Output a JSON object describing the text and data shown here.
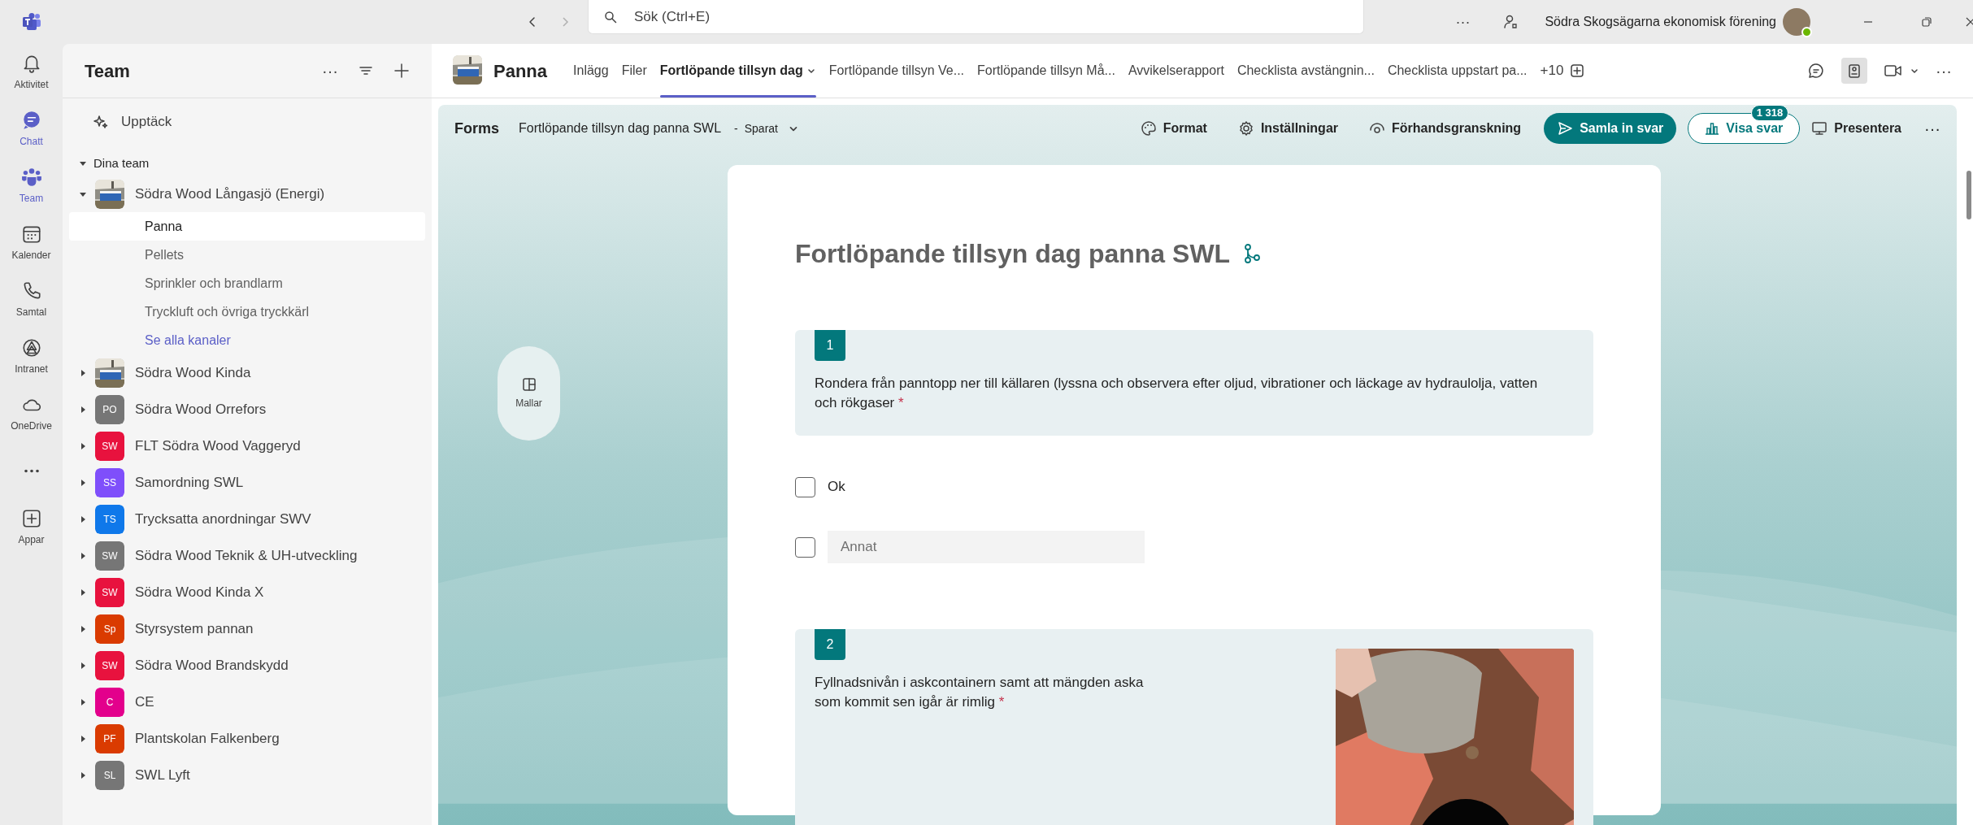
{
  "titlebar": {
    "search": {
      "placeholder": "Sök (Ctrl+E)"
    },
    "more": "···",
    "organization": "Södra Skogsägarna ekonomisk förening"
  },
  "rail": [
    {
      "kind": "app",
      "label": "Aktivitet",
      "selected": false
    },
    {
      "kind": "app",
      "label": "Chatt",
      "selected": true
    },
    {
      "kind": "app",
      "label": "Team",
      "selected": true
    },
    {
      "kind": "app",
      "label": "Kalender",
      "selected": false
    },
    {
      "kind": "app",
      "label": "Samtal",
      "selected": false
    },
    {
      "kind": "app",
      "label": "Intranet",
      "selected": false
    },
    {
      "kind": "app",
      "label": "OneDrive",
      "selected": false
    },
    {
      "kind": "more",
      "selected": false
    },
    {
      "kind": "app",
      "label": "Appar",
      "selected": false
    }
  ],
  "sidebar": {
    "title": "Team",
    "more": "···",
    "discover": "Upptäck",
    "section": {
      "label": "Dina team",
      "expanded": true
    },
    "teams": [
      {
        "name": "Södra Wood Långasjö (Energi)",
        "expanded": true,
        "channels": [
          {
            "name": "Panna",
            "selected": true
          },
          {
            "name": "Pellets",
            "selected": false
          },
          {
            "name": "Sprinkler och brandlarm",
            "selected": false
          },
          {
            "name": "Tryckluft och övriga tryckkärl",
            "selected": false
          }
        ],
        "link": "Se alla kanaler"
      },
      {
        "name": "Södra Wood Kinda",
        "expanded": false
      },
      {
        "name": "Södra Wood Orrefors",
        "kind": "initials",
        "initials": "PO",
        "color": "#767676",
        "expanded": false
      },
      {
        "name": "FLT Södra Wood Vaggeryd",
        "kind": "initials",
        "initials": "SW",
        "color": "#e8123e",
        "expanded": false
      },
      {
        "name": "Samordning SWL",
        "kind": "initials",
        "initials": "SS",
        "color": "#7f4ffb",
        "expanded": false
      },
      {
        "name": "Trycksatta anordningar SWV",
        "kind": "initials",
        "initials": "TS",
        "color": "#0f78ea",
        "expanded": false
      },
      {
        "name": "Södra Wood Teknik & UH-utveckling",
        "kind": "initials",
        "initials": "SW",
        "color": "#767676",
        "expanded": false
      },
      {
        "name": "Södra Wood Kinda X",
        "kind": "initials",
        "initials": "SW",
        "color": "#e8123e",
        "expanded": false
      },
      {
        "name": "Styrsystem pannan",
        "kind": "initials",
        "initials": "Sp",
        "color": "#da3b01",
        "expanded": false
      },
      {
        "name": "Södra Wood Brandskydd",
        "kind": "initials",
        "initials": "SW",
        "color": "#e8123e",
        "expanded": false
      },
      {
        "name": "CE",
        "kind": "initials",
        "initials": "C",
        "color": "#e3008c",
        "expanded": false
      },
      {
        "name": "Plantskolan Falkenberg",
        "kind": "initials",
        "initials": "PF",
        "color": "#da3b01",
        "expanded": false
      },
      {
        "name": "SWL Lyft",
        "kind": "initials",
        "initials": "SL",
        "color": "#767676",
        "expanded": false
      }
    ]
  },
  "channel": {
    "name": "Panna",
    "tabs": [
      {
        "label": "Inlägg",
        "selected": false
      },
      {
        "label": "Filer",
        "selected": false
      },
      {
        "label": "Fortlöpande tillsyn dag",
        "selected": true
      },
      {
        "label": "Fortlöpande tillsyn Ve...",
        "selected": false
      },
      {
        "label": "Fortlöpande tillsyn Må...",
        "selected": false
      },
      {
        "label": "Avvikelserapport",
        "selected": false
      },
      {
        "label": "Checklista avstängnin...",
        "selected": false
      },
      {
        "label": "Checklista uppstart pa...",
        "selected": false
      }
    ],
    "more_tabs": "+10",
    "more": "···"
  },
  "forms_toolbar": {
    "app": "Forms",
    "form_name": "Fortlöpande tillsyn dag panna SWL",
    "separator": "-",
    "status": "Sparat",
    "actions": [
      "Format",
      "Inställningar",
      "Förhandsgranskning"
    ],
    "collect": "Samla in svar",
    "responses": "Visa svar",
    "response_count": "1 318",
    "present": "Presentera",
    "more": "···"
  },
  "templates": {
    "label": "Mallar"
  },
  "form": {
    "title": "Fortlöpande tillsyn dag panna SWL",
    "questions": [
      {
        "number": "1",
        "text": "Rondera från panntopp ner till källaren (lyssna och observera efter oljud, vibrationer och läckage av hydraulolja, vatten och rökgaser",
        "required_mark": "*",
        "options": [
          {
            "kind": "choice",
            "label": "Ok",
            "checked": false
          },
          {
            "kind": "other",
            "placeholder": "Annat",
            "checked": false
          }
        ]
      },
      {
        "number": "2",
        "text": "Fyllnadsnivån i askcontainern samt att mängden aska som kommit sen igår är rimlig",
        "required_mark": "*"
      }
    ]
  }
}
